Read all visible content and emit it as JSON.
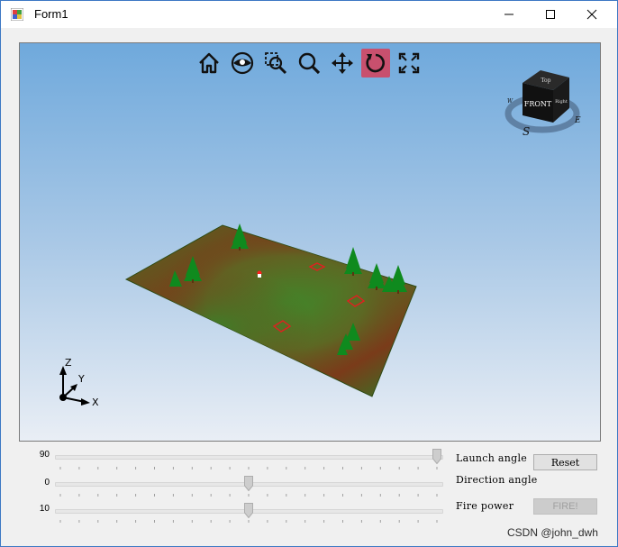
{
  "window": {
    "title": "Form1"
  },
  "toolbar": {
    "buttons": [
      {
        "name": "home-icon"
      },
      {
        "name": "eye-icon"
      },
      {
        "name": "zoom-window-icon"
      },
      {
        "name": "zoom-icon"
      },
      {
        "name": "pan-icon"
      },
      {
        "name": "rotate-icon",
        "active": true
      },
      {
        "name": "fit-extents-icon"
      }
    ],
    "active_color": "#c8506e"
  },
  "view_cube": {
    "front": "FRONT",
    "top": "Top",
    "right": "Right",
    "compass_s": "S",
    "compass_e": "E",
    "compass_w": "W"
  },
  "axes": {
    "x": "X",
    "y": "Y",
    "z": "Z"
  },
  "controls": {
    "launch_angle": {
      "value": "90",
      "label": "Launch angle",
      "fraction": 1.0
    },
    "direction_angle": {
      "value": "0",
      "label": "Direction angle",
      "fraction": 0.5
    },
    "fire_power": {
      "value": "10",
      "label": "Fire power",
      "fraction": 0.5
    },
    "reset_label": "Reset",
    "fire_label": "FIRE!"
  },
  "watermark": "CSDN @john_dwh"
}
